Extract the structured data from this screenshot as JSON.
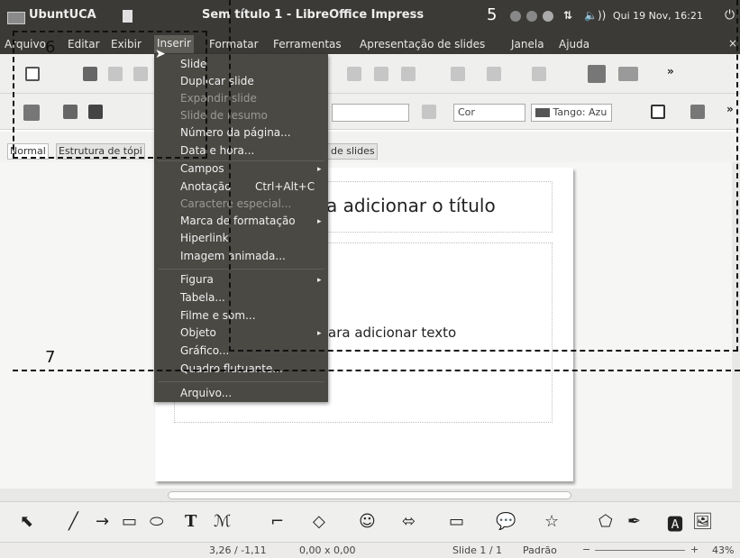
{
  "system_panel": {
    "app_name": "UbuntUCA",
    "window_title": "Sem título 1 - LibreOffice Impress",
    "network_indicator": "⇅",
    "volume_indicator": "🔈))",
    "clock": "Qui 19 Nov, 16:21",
    "power_icon": "power-icon"
  },
  "menubar": {
    "items": [
      "Arquivo",
      "Editar",
      "Exibir",
      "Inserir",
      "Formatar",
      "Ferramentas",
      "Apresentação de slides",
      "Janela",
      "Ajuda"
    ],
    "active": "Inserir",
    "close_glyph": "×"
  },
  "toolbar2": {
    "color_combo": "Cor",
    "color_name_combo": "Tango: Azu",
    "more_glyph": "»"
  },
  "toolbar1": {
    "more_glyph": "»"
  },
  "view_tabs": [
    "Normal",
    "Estrutura de tópicos",
    "Classificador de slides"
  ],
  "view_tabs_visible": [
    "Normal",
    "Estrutura de tópi",
    "r de slides"
  ],
  "slide": {
    "title_placeholder_visible": "a adicionar o título",
    "body_placeholder_visible": "ara adicionar texto"
  },
  "insert_menu": {
    "items": [
      {
        "label": "Slide",
        "enabled": true
      },
      {
        "label": "Duplicar slide",
        "enabled": true
      },
      {
        "label": "Expandir slide",
        "enabled": false
      },
      {
        "label": "Slide de resumo",
        "enabled": false
      },
      {
        "label": "Número da página...",
        "enabled": true
      },
      {
        "label": "Data e hora...",
        "enabled": true
      },
      {
        "label": "Campos",
        "enabled": true,
        "submenu": true
      },
      {
        "label": "Anotação",
        "enabled": true,
        "accelerator": "Ctrl+Alt+C"
      },
      {
        "label": "Caractere especial...",
        "enabled": false
      },
      {
        "label": "Marca de formatação",
        "enabled": true,
        "submenu": true
      },
      {
        "label": "Hiperlink",
        "enabled": true
      },
      {
        "label": "Imagem animada...",
        "enabled": true
      },
      {
        "label": "Figura",
        "enabled": true,
        "submenu": true
      },
      {
        "label": "Tabela...",
        "enabled": true
      },
      {
        "label": "Filme e som...",
        "enabled": true
      },
      {
        "label": "Objeto",
        "enabled": true,
        "submenu": true
      },
      {
        "label": "Gráfico...",
        "enabled": true
      },
      {
        "label": "Quadro flutuante...",
        "enabled": true
      },
      {
        "label": "Arquivo...",
        "enabled": true
      }
    ]
  },
  "statusbar": {
    "position": "3,26 / -1,11",
    "size": "0,00 x 0,00",
    "slide": "Slide 1 / 1",
    "layout": "Padrão",
    "zoom": "43%",
    "zoom_minus": "−",
    "zoom_plus": "+"
  },
  "annotations": {
    "label_5": "5",
    "label_6": "6",
    "label_7": "7"
  },
  "colors": {
    "panel_bg": "#3b3a36",
    "menu_bg": "#4a4944",
    "toolbar_bg": "#efefed",
    "swatch": "#555555"
  }
}
